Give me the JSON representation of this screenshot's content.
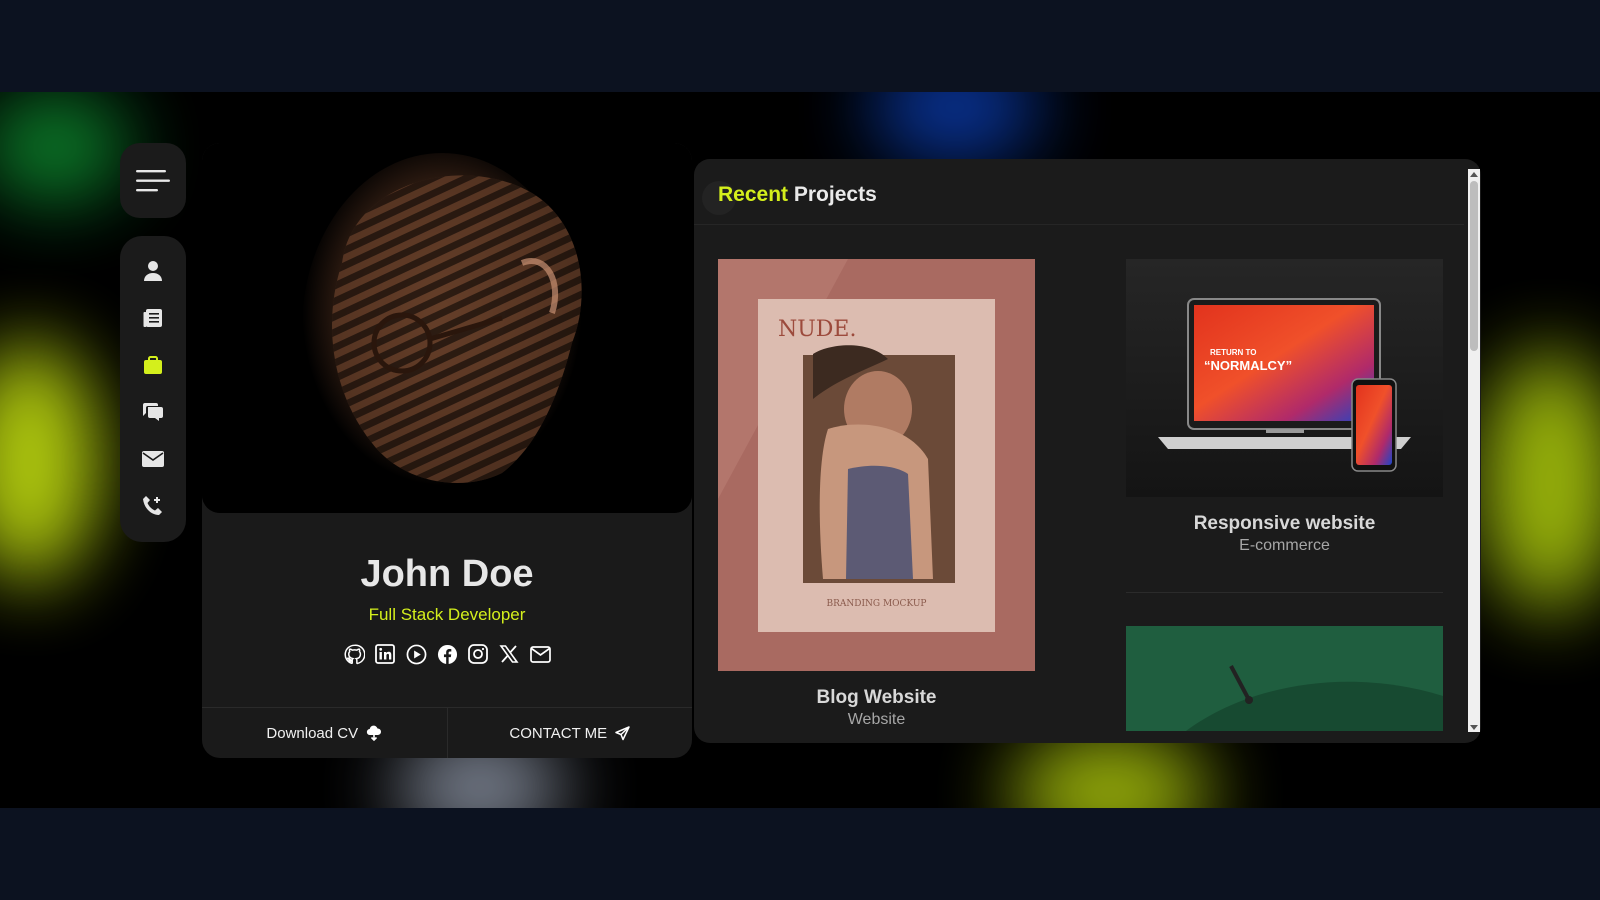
{
  "profile": {
    "name": "John Doe",
    "role": "Full Stack Developer",
    "download_label": "Download CV",
    "contact_label": "CONTACT ME",
    "socials": [
      "github-icon",
      "linkedin-icon",
      "play-icon",
      "facebook-icon",
      "instagram-icon",
      "x-icon",
      "mail-icon"
    ]
  },
  "nav": {
    "items": [
      "user-icon",
      "resume-icon",
      "briefcase-icon",
      "chat-icon",
      "envelope-icon",
      "phone-icon"
    ],
    "active": "briefcase-icon"
  },
  "projects": {
    "title_accent": "Recent",
    "title_rest": "Projects",
    "items": [
      {
        "title": "Blog Website",
        "subtitle": "Website",
        "mockup_brand": "NUDE.",
        "mockup_caption": "BRANDING MOCKUP"
      },
      {
        "title": "Responsive website",
        "subtitle": "E-commerce",
        "screen_kicker": "RETURN TO",
        "screen_headline": "“NORMALCY”"
      }
    ]
  },
  "colors": {
    "accent": "#d4ef1c",
    "panel": "#1b1b1b",
    "page_bg": "#0c1220"
  }
}
